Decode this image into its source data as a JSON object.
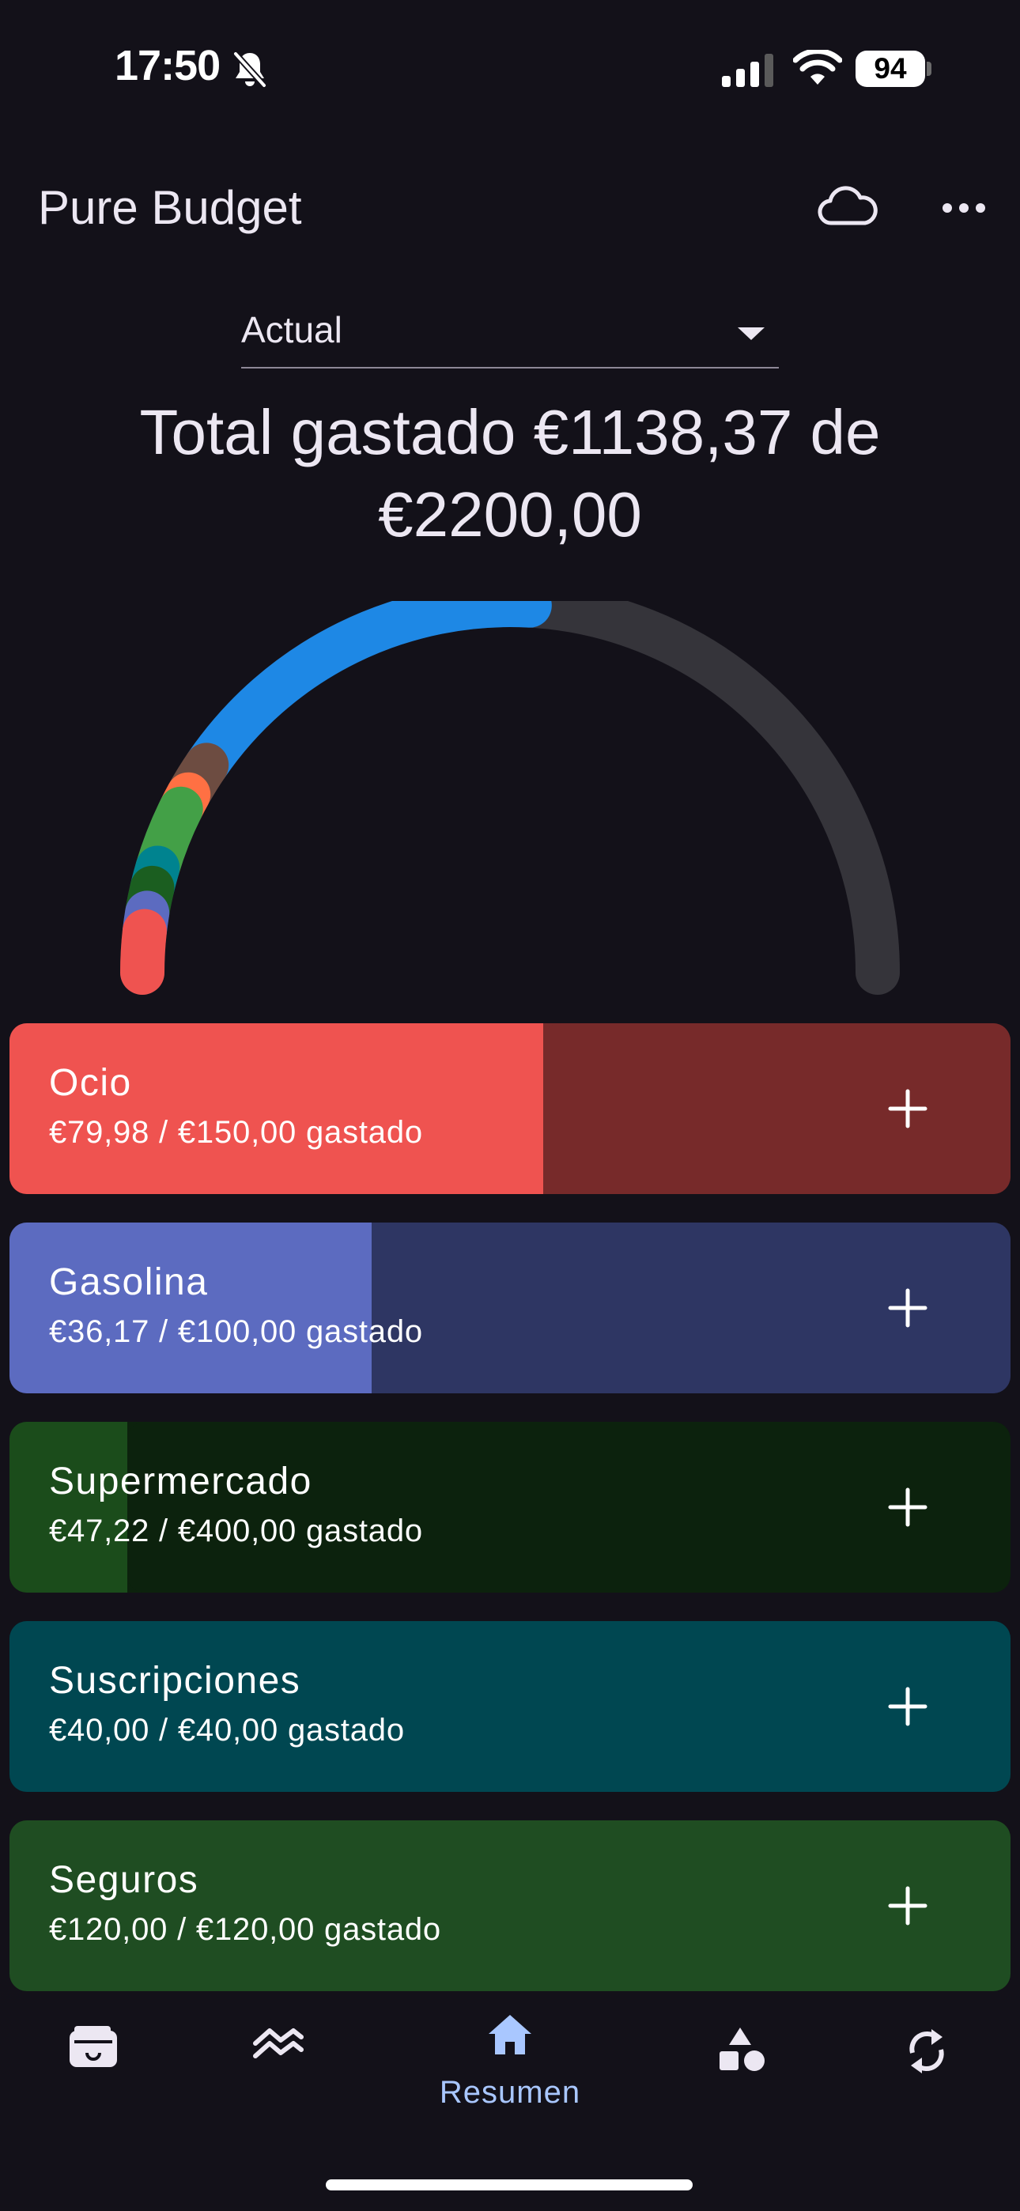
{
  "status_bar": {
    "time": "17:50",
    "battery": "94",
    "icons": [
      "bell-off-icon",
      "signal-icon",
      "wifi-icon",
      "battery-icon"
    ]
  },
  "app_bar": {
    "title": "Pure Budget",
    "actions": [
      "cloud-icon",
      "more-horizontal-icon"
    ]
  },
  "period": {
    "value": "Actual"
  },
  "summary": {
    "line1": "Total gastado €1138,37 de",
    "line2": "€2200,00",
    "spent_fraction": 0.517
  },
  "gauge": {
    "track_color": "#35343A",
    "segments": [
      {
        "color": "#EF5350",
        "fraction": 0.036
      },
      {
        "color": "#5C6BC0",
        "fraction": 0.016
      },
      {
        "color": "#1B5E20",
        "fraction": 0.022
      },
      {
        "color": "#00838F",
        "fraction": 0.018
      },
      {
        "color": "#43A047",
        "fraction": 0.055
      },
      {
        "color": "#FF7043",
        "fraction": 0.014
      },
      {
        "color": "#6D4C41",
        "fraction": 0.03
      },
      {
        "color": "#1E88E5",
        "fraction": 0.326
      }
    ]
  },
  "categories": [
    {
      "name": "Ocio",
      "amount": "€79,98 / €150,00 gastado",
      "spent_fraction": 0.533,
      "fill_color": "#EF5350",
      "remaining_color": "#772A2A"
    },
    {
      "name": "Gasolina",
      "amount": "€36,17 / €100,00 gastado",
      "spent_fraction": 0.362,
      "fill_color": "#5C6BC0",
      "remaining_color": "#2E3663"
    },
    {
      "name": "Supermercado",
      "amount": "€47,22 / €400,00 gastado",
      "spent_fraction": 0.118,
      "fill_color": "#1B4C1B",
      "remaining_color": "#0C220D"
    },
    {
      "name": "Suscripciones",
      "amount": "€40,00 / €40,00 gastado",
      "spent_fraction": 1.0,
      "fill_color": "#004751",
      "remaining_color": "#00242A"
    },
    {
      "name": "Seguros",
      "amount": "€120,00 / €120,00 gastado",
      "spent_fraction": 1.0,
      "fill_color": "#1F4D22",
      "remaining_color": "#10280F"
    }
  ],
  "bottom_nav": {
    "items": [
      {
        "icon": "wallet-icon",
        "label": ""
      },
      {
        "icon": "trend-icon",
        "label": ""
      },
      {
        "icon": "home-icon",
        "label": "Resumen",
        "active": true
      },
      {
        "icon": "shapes-icon",
        "label": ""
      },
      {
        "icon": "sync-icon",
        "label": ""
      }
    ],
    "active_color": "#A9C7FF"
  }
}
